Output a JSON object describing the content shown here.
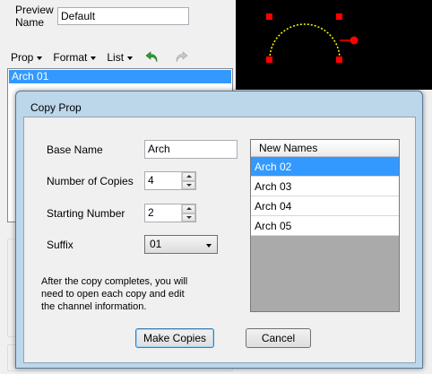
{
  "editor": {
    "preview_name_label": "Preview Name",
    "preview_name_value": "Default",
    "menu": [
      "Prop",
      "Format",
      "List"
    ],
    "prop_list": [
      "Arch 01"
    ]
  },
  "canvas": {
    "background": "#000000",
    "arc_color": "#ffff00",
    "handle_color": "#ff0000"
  },
  "dialog": {
    "title": "Copy Prop",
    "base_name_label": "Base Name",
    "base_name_value": "Arch",
    "copies_label": "Number of Copies",
    "copies_value": "4",
    "start_label": "Starting Number",
    "start_value": "2",
    "suffix_label": "Suffix",
    "suffix_value": "01",
    "note_line1": "After the copy completes, you will",
    "note_line2": "need to open each copy and edit",
    "note_line3": "the channel information.",
    "names_header": "New Names",
    "names": [
      "Arch 02",
      "Arch 03",
      "Arch 04",
      "Arch 05"
    ],
    "make_copies_label": "Make Copies",
    "cancel_label": "Cancel",
    "selection_color": "#3399ff"
  }
}
